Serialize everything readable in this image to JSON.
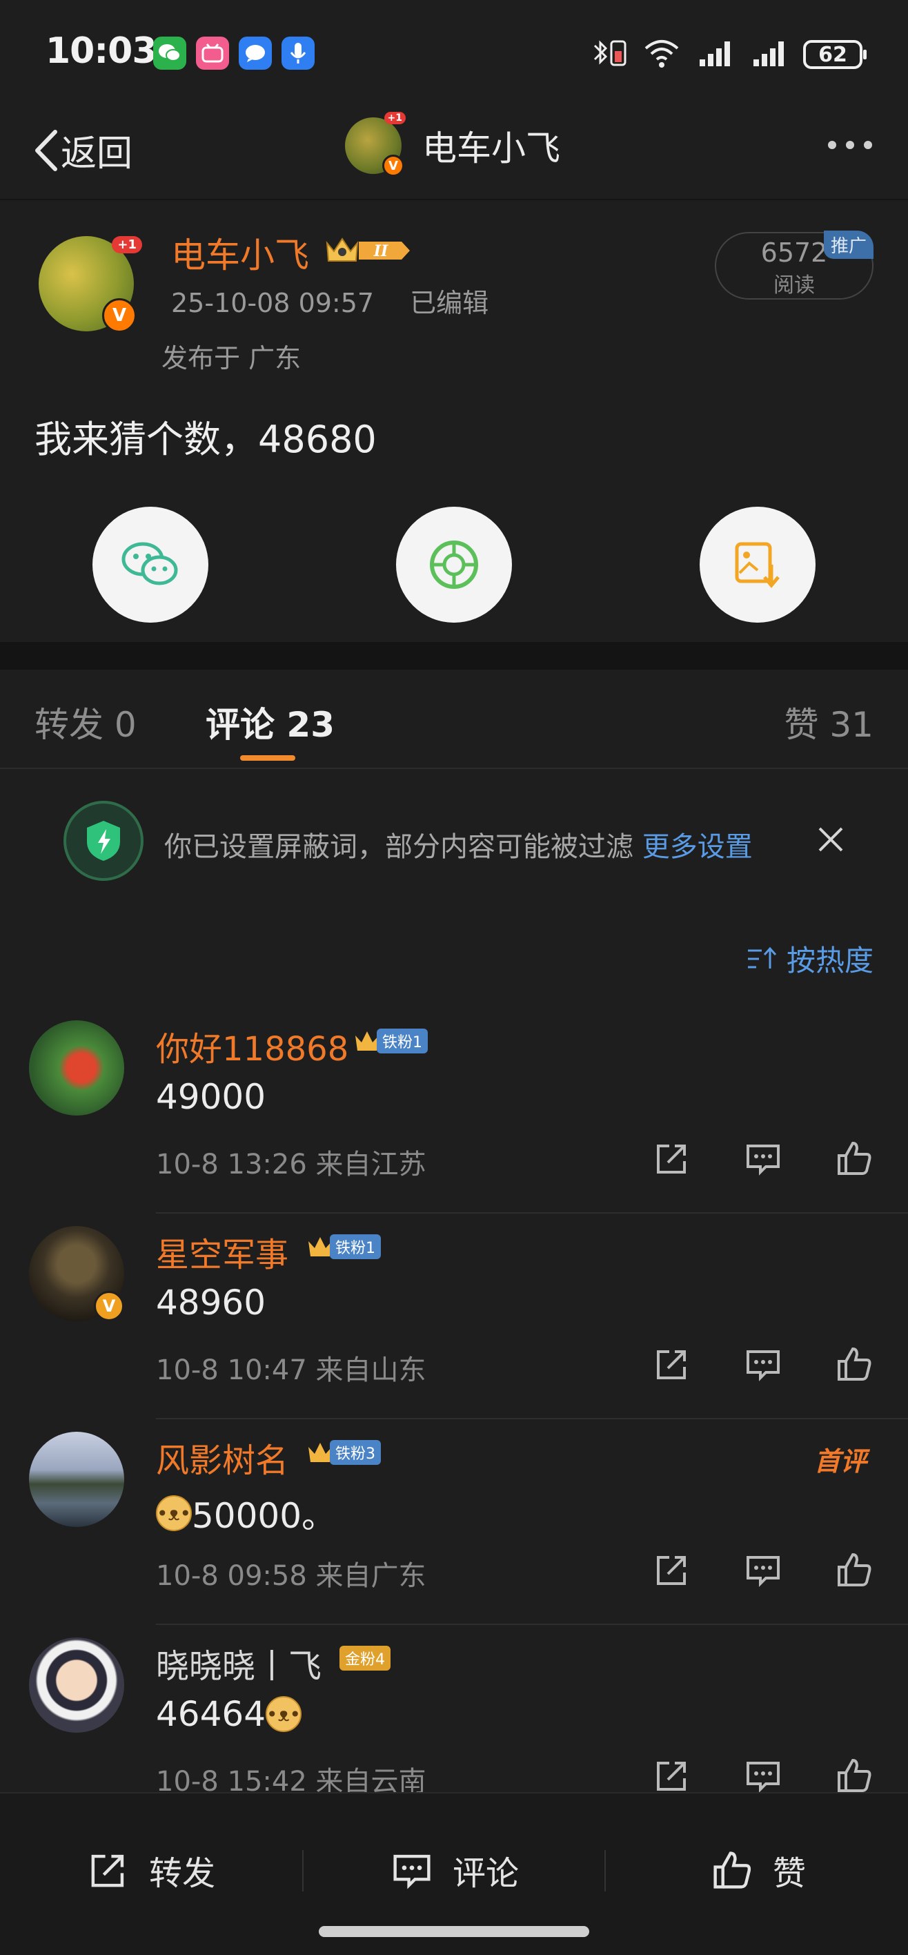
{
  "status_bar": {
    "time": "10:03",
    "battery": "62",
    "notification_icons": [
      "wechat-icon",
      "bilibili-icon",
      "message-icon",
      "voice-icon"
    ]
  },
  "nav": {
    "back_label": "返回",
    "title": "电车小飞",
    "avatar_badge": "+1"
  },
  "post": {
    "author": "电车小飞",
    "level": "II",
    "date": "25-10-08 09:57",
    "edited": "已编辑",
    "location": "发布于 广东",
    "read_count": "6572",
    "read_label": "阅读",
    "promo_label": "推广",
    "avatar_badge": "+1",
    "text": "我来猜个数，48680",
    "share_targets": [
      "wechat-icon",
      "moments-icon",
      "save-image-icon"
    ]
  },
  "tabs": {
    "repost": "转发 0",
    "comments": "评论 23",
    "likes": "赞 31"
  },
  "notice": {
    "text": "你已设置屏蔽词，部分内容可能被过滤",
    "link": "更多设置"
  },
  "sort_label": "按热度",
  "comments": [
    {
      "name": "你好118868",
      "fan": "铁粉1",
      "fan_type": "iron",
      "text": "49000",
      "meta": "10-8 13:26 来自江苏",
      "verified": false,
      "first": ""
    },
    {
      "name": "星空军事",
      "fan": "铁粉1",
      "fan_type": "iron",
      "text": "48960",
      "meta": "10-8 10:47 来自山东",
      "verified": true,
      "first": ""
    },
    {
      "name": "风影树名",
      "fan": "铁粉3",
      "fan_type": "iron",
      "text": "50000。",
      "meta": "10-8 09:58 来自广东",
      "verified": false,
      "first": "首评"
    },
    {
      "name": "晓晓晓丨飞",
      "fan": "金粉4",
      "fan_type": "gold",
      "text": "46464",
      "meta": "10-8 15:42 来自云南",
      "verified": false,
      "first": ""
    }
  ],
  "bottom_bar": {
    "repost": "转发",
    "comment": "评论",
    "like": "赞"
  },
  "colors": {
    "background": "#1e1e1e",
    "accent_orange": "#f07a2a",
    "link_blue": "#5a9be6"
  }
}
